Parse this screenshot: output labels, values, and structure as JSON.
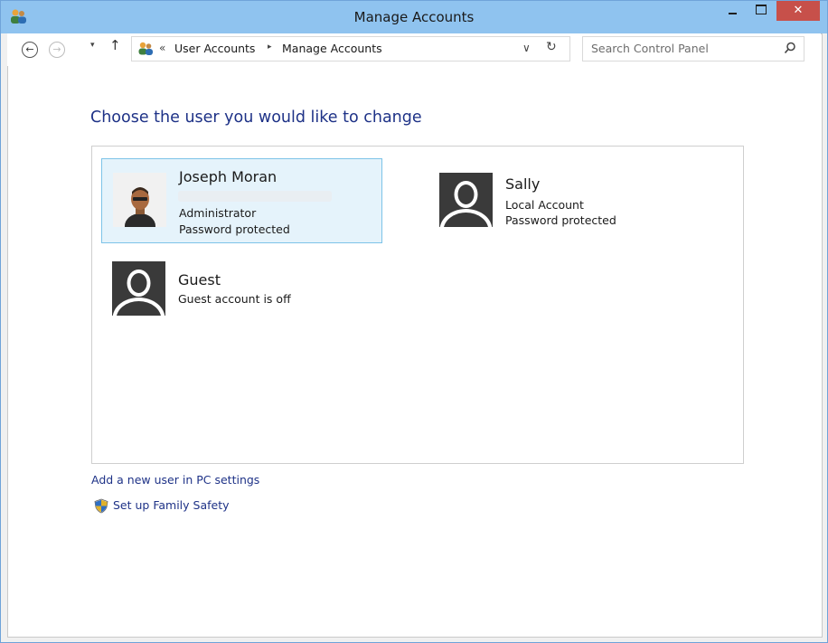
{
  "window": {
    "title": "Manage Accounts",
    "close_glyph": "✕",
    "icons": {
      "app": "users-icon",
      "minimize": "minimize-icon",
      "maximize": "maximize-icon",
      "close": "close-icon"
    }
  },
  "nav": {
    "back_glyph": "←",
    "forward_glyph": "→",
    "recent_glyph": "▾",
    "up_glyph": "↑",
    "breadcrumb_overflow": "«",
    "breadcrumb": [
      "User Accounts",
      "Manage Accounts"
    ],
    "breadcrumb_separator": "▸",
    "address_dropdown_glyph": "∨",
    "refresh_glyph": "↻",
    "search_placeholder": "Search Control Panel"
  },
  "main": {
    "heading": "Choose the user you would like to change",
    "accounts": [
      {
        "name": "Joseph Moran",
        "details": [
          "Administrator",
          "Password protected"
        ],
        "selected": true,
        "avatar": "photo-avatar"
      },
      {
        "name": "Sally",
        "details": [
          "Local Account",
          "Password protected"
        ],
        "selected": false,
        "avatar": "default-user-avatar"
      },
      {
        "name": "Guest",
        "details": [
          "Guest account is off"
        ],
        "selected": false,
        "avatar": "default-user-avatar"
      }
    ],
    "links": [
      {
        "label": "Add a new user in PC settings"
      },
      {
        "label": "Set up Family Safety",
        "icon": "shield-icon"
      }
    ]
  },
  "colors": {
    "titlebar": "#8fc3ef",
    "close_button": "#c7504a",
    "link": "#1e3287",
    "selected_tile": "#e5f3fb",
    "avatar": "#3a3a3a"
  }
}
